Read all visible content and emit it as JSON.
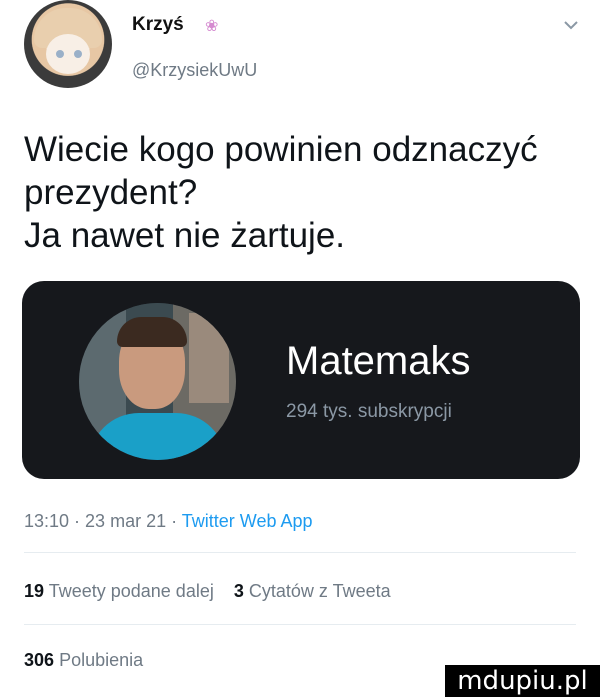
{
  "author": {
    "display_name": "Krzyś",
    "emoji": "❀",
    "handle": "@KrzysiekUwU"
  },
  "tweet": {
    "text": "Wiecie kogo powinien odznaczyć\nprezydent?\nJa nawet nie żartuje."
  },
  "card": {
    "title": "Matemaks",
    "subtitle": "294 tys. subskrypcji"
  },
  "meta": {
    "time": "13:10",
    "separator": " · ",
    "date": "23 mar 21",
    "source": "Twitter Web App"
  },
  "stats": {
    "retweets_count": "19",
    "retweets_label": "Tweety podane dalej",
    "quotes_count": "3",
    "quotes_label": "Cytatów z Tweeta",
    "likes_count": "306",
    "likes_label": "Polubienia"
  },
  "watermark": {
    "text": "mdupiu.pl"
  }
}
